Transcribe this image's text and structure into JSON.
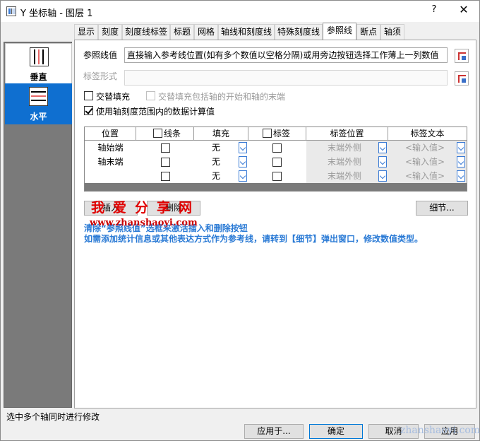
{
  "window": {
    "title": "Y 坐标轴 - 图层 1",
    "help": "?",
    "close": "✕"
  },
  "tabs": [
    "显示",
    "刻度",
    "刻度线标签",
    "标题",
    "网格",
    "轴线和刻度线",
    "特殊刻度线",
    "参照线",
    "断点",
    "轴须"
  ],
  "sidebar": {
    "items": [
      {
        "label": "垂直"
      },
      {
        "label": "水平"
      }
    ]
  },
  "refline": {
    "label": "参照线值",
    "value": "直接输入参考线位置(如有多个数值以空格分隔)或用旁边按钮选择工作薄上一列数值",
    "label_format_label": "标签形式",
    "label_format_value": ""
  },
  "options": {
    "alt_fill": "交替填充",
    "alt_fill_include": "交替填充包括轴的开始和轴的末端",
    "use_tick_range": "使用轴刻度范围内的数据计算值"
  },
  "table": {
    "headers": [
      "位置",
      "线条",
      "填充",
      "标签",
      "标签位置",
      "标签文本"
    ],
    "rows": [
      {
        "position": "轴始端",
        "fill": "无",
        "label_pos": "末端外侧",
        "label_text": "<输入值>"
      },
      {
        "position": "轴末端",
        "fill": "无",
        "label_pos": "末端外侧",
        "label_text": "<输入值>"
      },
      {
        "position": "",
        "fill": "无",
        "label_pos": "末端外侧",
        "label_text": "<输入值>"
      }
    ]
  },
  "buttons": {
    "insert": "插入",
    "delete": "删除",
    "detail": "细节..."
  },
  "notes": [
    "清除“参照线值”选框来激活插入和删除按钮",
    "如需添加统计信息或其他表达方式作为参考线，请转到【细节】弹出窗口，修改数值类型。"
  ],
  "watermark": {
    "big": "我爱分享网",
    "url": "www.zhanshaoyi.com",
    "corner": "zhanshaoyi.com"
  },
  "status": "选中多个轴同时进行修改",
  "footer": {
    "apply": "应用于...",
    "ok": "确定",
    "cancel": "取消",
    "apply_btn": "应用"
  }
}
